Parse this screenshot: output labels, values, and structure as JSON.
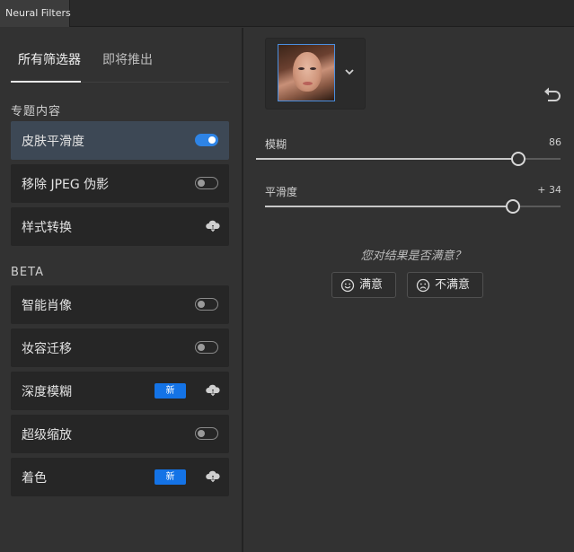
{
  "window": {
    "tab_title": "Neural Filters"
  },
  "left_tabs": {
    "all_filters": "所有筛选器",
    "coming_soon": "即将推出"
  },
  "sections": {
    "featured": "专题内容",
    "beta": "BETA"
  },
  "featured_filters": [
    {
      "label": "皮肤平滑度",
      "control": "toggle-on"
    },
    {
      "label": "移除 JPEG 伪影",
      "control": "toggle-off"
    },
    {
      "label": "样式转换",
      "control": "cloud-download-icon"
    }
  ],
  "beta_filters": [
    {
      "label": "智能肖像",
      "control": "toggle-off"
    },
    {
      "label": "妆容迁移",
      "control": "toggle-off"
    },
    {
      "label": "深度模糊",
      "control": "cloud-download-icon",
      "badge": "新"
    },
    {
      "label": "超级缩放",
      "control": "toggle-off"
    },
    {
      "label": "着色",
      "control": "cloud-download-icon",
      "badge": "新"
    }
  ],
  "sliders": [
    {
      "label": "模糊",
      "value_text": "86",
      "value": 86,
      "min": 0,
      "max": 100
    },
    {
      "label": "平滑度",
      "value_text": "+ 34",
      "value": 34,
      "min": -50,
      "max": 50
    }
  ],
  "feedback": {
    "question": "您对结果是否满意？",
    "satisfied": "满意",
    "unsatisfied": "不满意"
  },
  "colors": {
    "accent": "#2e84e6",
    "badge": "#1473e6",
    "active_item": "#3d4855"
  }
}
